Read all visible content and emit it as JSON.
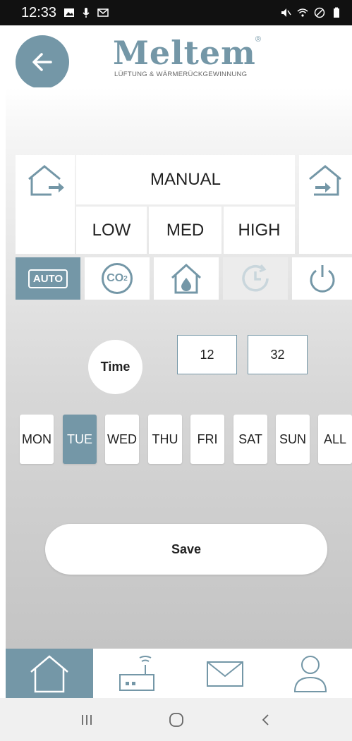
{
  "status_bar": {
    "time": "12:33"
  },
  "header": {
    "logo_text": "Meltem",
    "logo_tagline": "LÜFTUNG & WÄRMERÜCKGEWINNUNG",
    "logo_registered": "®"
  },
  "mode": {
    "manual_label": "MANUAL",
    "levels": [
      "LOW",
      "MED",
      "HIGH"
    ]
  },
  "mode_icons": {
    "auto_label": "AUTO",
    "co2_label": "CO",
    "co2_sub": "2"
  },
  "time": {
    "label": "Time",
    "hour": "12",
    "minute": "32"
  },
  "days": [
    "MON",
    "TUE",
    "WED",
    "THU",
    "FRI",
    "SAT",
    "SUN",
    "ALL"
  ],
  "selected_day": "TUE",
  "save_label": "Save",
  "colors": {
    "accent": "#7497a7",
    "background_top": "#ffffff",
    "background_bottom": "#c4c4c4"
  }
}
